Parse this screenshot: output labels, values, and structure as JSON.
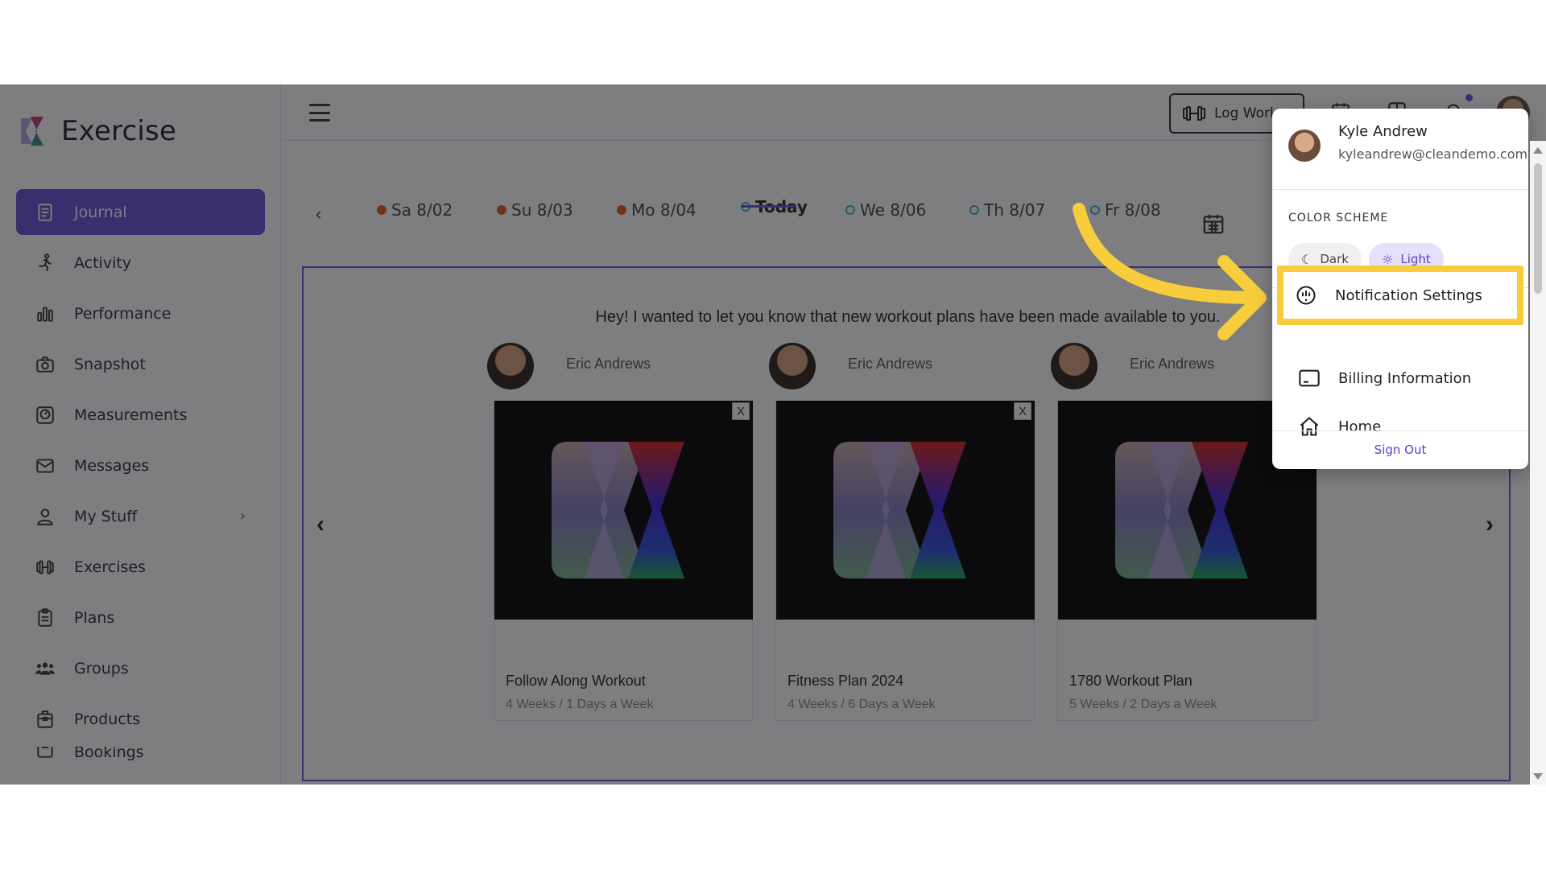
{
  "app": {
    "name": "Exercise"
  },
  "colors": {
    "accent": "#6a4fd8",
    "highlight": "#f7cd3c",
    "missed_dot": "#e2591e",
    "future_dot": "#41a9d6"
  },
  "sidebar": {
    "items": [
      {
        "label": "Journal",
        "icon": "journal-icon",
        "active": true
      },
      {
        "label": "Activity",
        "icon": "running-icon"
      },
      {
        "label": "Performance",
        "icon": "bar-chart-icon"
      },
      {
        "label": "Snapshot",
        "icon": "camera-icon"
      },
      {
        "label": "Measurements",
        "icon": "scale-icon"
      },
      {
        "label": "Messages",
        "icon": "envelope-icon"
      },
      {
        "label": "My Stuff",
        "icon": "person-icon",
        "has_submenu": true
      },
      {
        "label": "Exercises",
        "icon": "dumbbell-icon"
      },
      {
        "label": "Plans",
        "icon": "clipboard-icon"
      },
      {
        "label": "Groups",
        "icon": "group-icon"
      },
      {
        "label": "Products",
        "icon": "box-icon"
      },
      {
        "label": "Bookings",
        "icon": "list-icon",
        "clipped": true
      }
    ]
  },
  "topbar": {
    "log_workout_label": "Log Workout",
    "icons": [
      "menu-icon",
      "dumbbell-icon",
      "calendar-icon",
      "apps-icon",
      "bell-icon",
      "user-avatar"
    ]
  },
  "date_strip": {
    "days": [
      {
        "label": "Sa 8/02",
        "status": "missed"
      },
      {
        "label": "Su 8/03",
        "status": "missed"
      },
      {
        "label": "Mo 8/04",
        "status": "missed"
      },
      {
        "label": "Today",
        "status": "today"
      },
      {
        "label": "We 8/06",
        "status": "upcoming"
      },
      {
        "label": "Th 8/07",
        "status": "upcoming"
      },
      {
        "label": "Fr 8/08",
        "status": "upcoming"
      }
    ]
  },
  "message": {
    "text": "Hey! I wanted to let you know that new workout plans have been made available to you.",
    "cards": [
      {
        "author": "Eric Andrews",
        "title": "Follow Along Workout",
        "subtitle": "4 Weeks / 1 Days a Week",
        "close": "X"
      },
      {
        "author": "Eric Andrews",
        "title": "Fitness Plan 2024",
        "subtitle": "4 Weeks / 6 Days a Week",
        "close": "X"
      },
      {
        "author": "Eric Andrews",
        "title": "1780 Workout Plan",
        "subtitle": "5 Weeks / 2 Days a Week",
        "close": ""
      }
    ]
  },
  "dropdown": {
    "user_name": "Kyle Andrew",
    "user_email": "kyleandrew@cleandemo.com",
    "scheme_heading": "COLOR SCHEME",
    "scheme_dark": "Dark",
    "scheme_light": "Light",
    "scheme_selected": "Light",
    "items": [
      {
        "label": "Notification Settings",
        "icon": "notification-settings-icon",
        "highlighted": true
      },
      {
        "label": "Billing Information",
        "icon": "billing-icon"
      },
      {
        "label": "Home",
        "icon": "home-icon"
      }
    ],
    "sign_out": "Sign Out"
  }
}
